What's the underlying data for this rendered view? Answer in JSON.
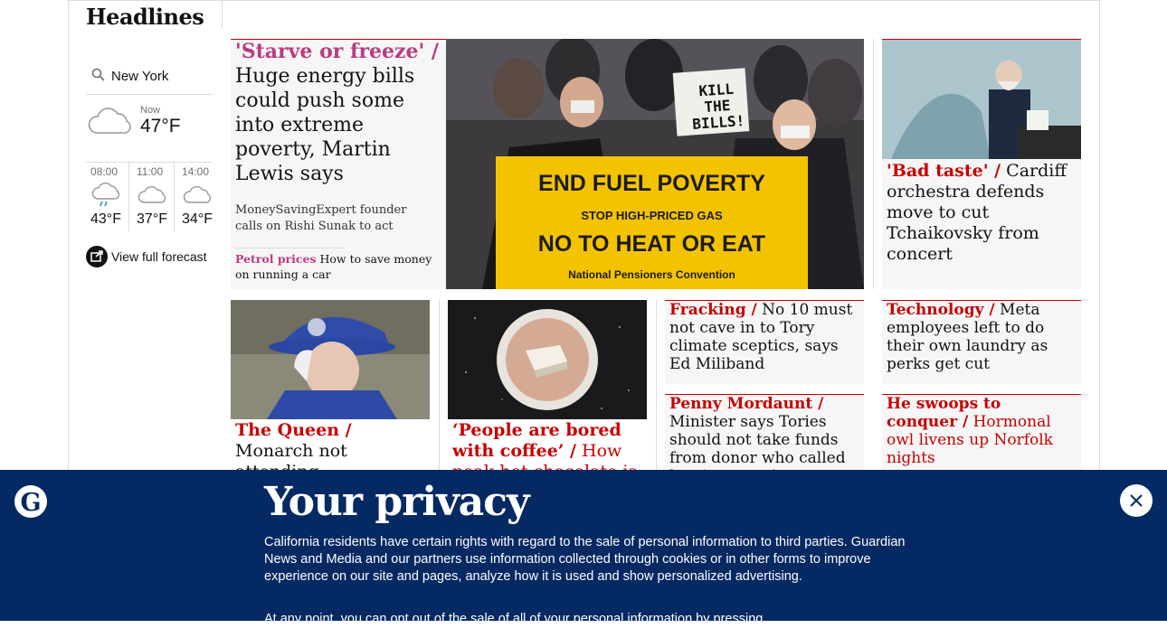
{
  "section": {
    "title": "Headlines"
  },
  "weather": {
    "location": "New York",
    "now_label": "Now",
    "now_temp": "47°F",
    "hours": [
      {
        "time": "08:00",
        "temp": "43°F",
        "icon": "rain-cloud-icon"
      },
      {
        "time": "11:00",
        "temp": "37°F",
        "icon": "cloud-icon"
      },
      {
        "time": "14:00",
        "temp": "34°F",
        "icon": "cloud-icon"
      }
    ],
    "forecast_label": "View full forecast"
  },
  "lead": {
    "kicker": "'Starve or freeze' /",
    "headline": "Huge energy bills could push some into extreme poverty, Martin Lewis says",
    "standfirst": "MoneySavingExpert founder calls on Rishi Sunak to act",
    "sublink_kicker": "Petrol prices",
    "sublink_text": "How to save money on running a car",
    "image_text": {
      "sign_small": "KILL THE BILLS!",
      "banner_line1": "END FUEL POVERTY",
      "banner_line2": "STOP HIGH-PRICED GAS",
      "banner_line3": "NO TO HEAT OR EAT",
      "banner_line4": "National Pensioners Convention"
    }
  },
  "cardiff": {
    "kicker": "'Bad taste' /",
    "headline": "Cardiff orchestra defends move to cut Tchaikovsky from concert"
  },
  "queen": {
    "kicker": "The Queen /",
    "headline": "Monarch not attending Commonwealth Day service"
  },
  "coffee": {
    "kicker": "‘People are bored with coffee’ /",
    "headline": "How peak hot chocolate is"
  },
  "fracking": {
    "kicker": "Fracking /",
    "headline": "No 10 must not cave in to Tory climate sceptics, says Ed Miliband"
  },
  "meta": {
    "kicker": "Technology /",
    "headline": "Meta employees left to do their own laundry as perks get cut"
  },
  "mordaunt": {
    "kicker": "Penny Mordaunt /",
    "headline": "Minister says Tories should not take funds from donor who called her ‘a tranny’"
  },
  "owl": {
    "kicker": "He swoops to conquer /",
    "headline": "Hormonal owl livens up Norfolk nights"
  },
  "privacy": {
    "title": "Your privacy",
    "paragraph1": "California residents have certain rights with regard to the sale of personal information to third parties. Guardian News and Media and our partners use information collected through cookies or in other forms to improve experience on our site and pages, analyze how it is used and show personalized advertising.",
    "paragraph2": "At any point, you can opt out of the sale of all of your personal information by pressing"
  },
  "colors": {
    "news_red": "#c70000",
    "lifestyle_pink": "#bb3b80",
    "banner_blue": "#052962",
    "card_grey": "#f6f6f6"
  }
}
